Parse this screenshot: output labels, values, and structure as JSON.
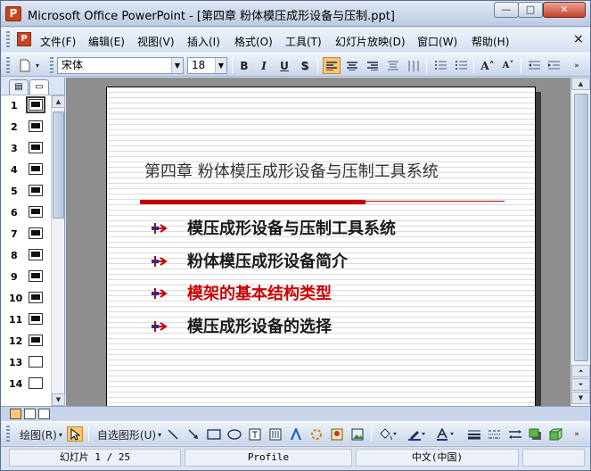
{
  "window": {
    "title": "Microsoft Office PowerPoint - [第四章 粉体模压成形设备与压制.ppt]",
    "min_glyph": "—",
    "max_glyph": "□",
    "close_glyph": "✕"
  },
  "menu": {
    "items": [
      {
        "label": "文件(F)"
      },
      {
        "label": "编辑(E)"
      },
      {
        "label": "视图(V)"
      },
      {
        "label": "插入(I)"
      },
      {
        "label": "格式(O)"
      },
      {
        "label": "工具(T)"
      },
      {
        "label": "幻灯片放映(D)"
      },
      {
        "label": "窗口(W)"
      },
      {
        "label": "帮助(H)"
      }
    ],
    "close_glyph": "×"
  },
  "toolbar": {
    "font_name": "宋体",
    "font_size": "18",
    "bold": "B",
    "italic": "I",
    "underline": "U",
    "shadow": "S",
    "grow": "A˄",
    "shrink": "A˅"
  },
  "outline_tabs": {
    "outline": "▤",
    "slides": "▭"
  },
  "slides_pane": {
    "numbers": [
      "1",
      "2",
      "3",
      "4",
      "5",
      "6",
      "7",
      "8",
      "9",
      "10",
      "11",
      "12",
      "13",
      "14"
    ],
    "selected": "1"
  },
  "slide": {
    "title": "第四章  粉体模压成形设备与压制工具系统",
    "bullets": [
      {
        "text": "模压成形设备与压制工具系统",
        "color": "#1a1a1a"
      },
      {
        "text": "粉体模压成形设备简介",
        "color": "#1a1a1a"
      },
      {
        "text": "模架的基本结构类型",
        "color": "#cc0000"
      },
      {
        "text": "模压成形设备的选择",
        "color": "#1a1a1a"
      }
    ],
    "accent_color": "#c00000"
  },
  "drawing_toolbar": {
    "draw_label": "绘图(R)",
    "autoshapes_label": "自选图形(U)"
  },
  "status": {
    "slide_info": "幻灯片 1 / 25",
    "design": "Profile",
    "language": "中文(中国)"
  }
}
